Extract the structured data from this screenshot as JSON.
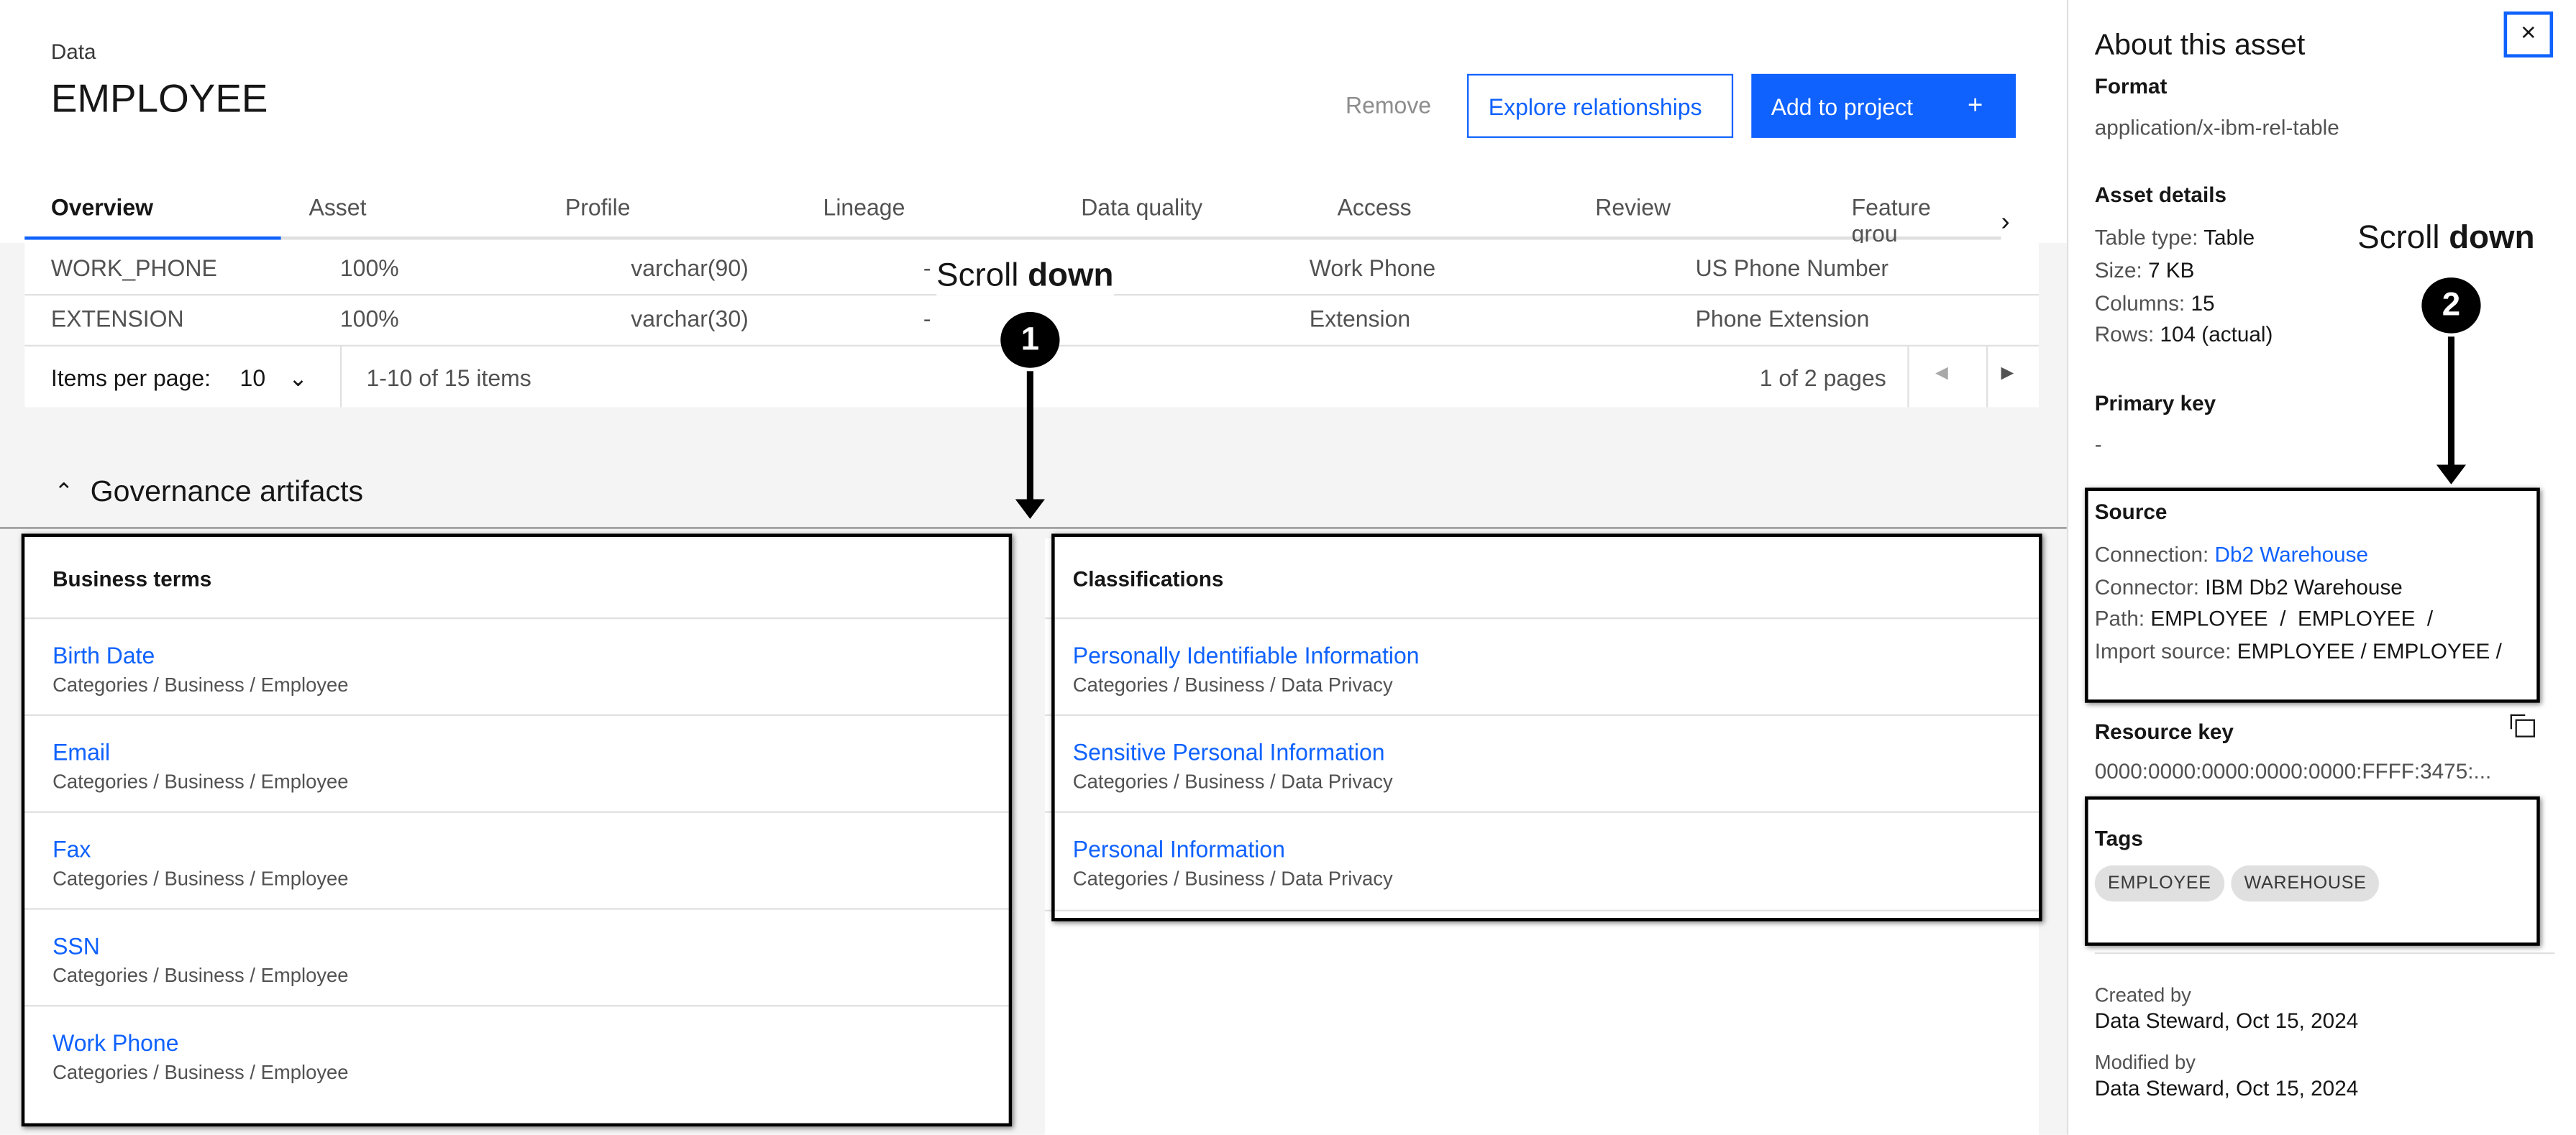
{
  "header": {
    "breadcrumb": "Data",
    "title": "EMPLOYEE",
    "remove_label": "Remove",
    "explore_label": "Explore relationships",
    "add_label": "Add to project",
    "add_icon": "+"
  },
  "tabs": [
    "Overview",
    "Asset",
    "Profile",
    "Lineage",
    "Data quality",
    "Access",
    "Review",
    "Feature grou"
  ],
  "table": {
    "rows": [
      [
        "WORK_PHONE",
        "100%",
        "varchar(90)",
        "-",
        "Work Phone",
        "US Phone Number"
      ],
      [
        "EXTENSION",
        "100%",
        "varchar(30)",
        "-",
        "Extension",
        "Phone Extension"
      ]
    ],
    "items_per_page_label": "Items per page:",
    "items_per_page": "10",
    "range": "1-10 of 15 items",
    "pages": "1 of 2 pages"
  },
  "governance": {
    "title": "Governance artifacts",
    "business_terms": {
      "title": "Business terms",
      "items": [
        {
          "name": "Birth Date",
          "path": "Categories  /  Business / Employee"
        },
        {
          "name": "Email",
          "path": "Categories  /  Business / Employee"
        },
        {
          "name": "Fax",
          "path": "Categories  /  Business / Employee"
        },
        {
          "name": "SSN",
          "path": "Categories  /  Business / Employee"
        },
        {
          "name": "Work Phone",
          "path": "Categories  /  Business / Employee"
        }
      ]
    },
    "classifications": {
      "title": "Classifications",
      "items": [
        {
          "name": "Personally Identifiable Information",
          "path": "Categories  /  Business / Data Privacy"
        },
        {
          "name": "Sensitive Personal Information",
          "path": "Categories  /  Business / Data Privacy"
        },
        {
          "name": "Personal Information",
          "path": "Categories  /  Business / Data Privacy"
        }
      ]
    }
  },
  "annotations": {
    "one": {
      "text": "Scroll ",
      "bold": "down",
      "num": "1"
    },
    "two": {
      "text": "Scroll ",
      "bold": "down",
      "num": "2"
    }
  },
  "panel": {
    "title": "About this asset",
    "close": "×",
    "format_label": "Format",
    "format": "application/x-ibm-rel-table",
    "details_label": "Asset details",
    "table_type_label": "Table type: ",
    "table_type": "Table",
    "size_label": "Size: ",
    "size": "7 KB",
    "columns_label": "Columns: ",
    "columns": "15",
    "rows_label": "Rows: ",
    "rows": "104 (actual)",
    "pk_label": "Primary key",
    "pk": "-",
    "source_label": "Source",
    "connection_label": "Connection: ",
    "connection": "Db2 Warehouse",
    "connector_label": "Connector: ",
    "connector": "IBM Db2 Warehouse",
    "path_label": "Path: ",
    "path": "EMPLOYEE  /  EMPLOYEE  /",
    "import_label": "Import source: ",
    "import": "EMPLOYEE / EMPLOYEE /",
    "resource_key_label": "Resource key",
    "resource_key": "0000:0000:0000:0000:0000:FFFF:3475:...",
    "tags_label": "Tags",
    "tags": [
      "EMPLOYEE",
      "WAREHOUSE"
    ],
    "created_label": "Created by",
    "created": "Data Steward, Oct 15, 2024",
    "modified_label": "Modified by",
    "modified": "Data Steward, Oct 15, 2024"
  },
  "colors": {
    "accent": "#0f62fe",
    "background": "#f4f4f4"
  }
}
